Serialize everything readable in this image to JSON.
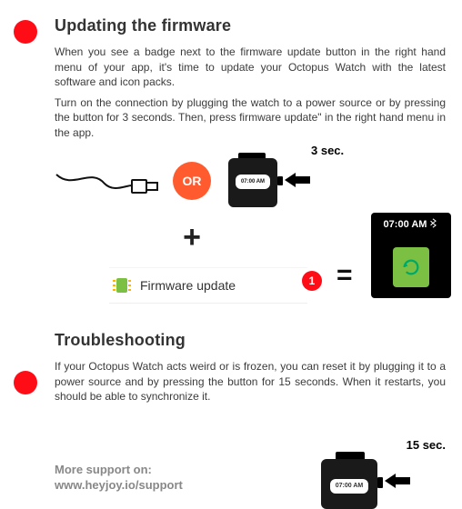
{
  "accent_red": "#ff0d17",
  "accent_orange": "#ff5b2e",
  "accent_green": "#7bc043",
  "section1": {
    "heading": "Updating the firmware",
    "para1": "When you see a badge next to the firmware update button in the right hand menu of your app, it's time to update your Octopus Watch with the latest software and icon packs.",
    "para2": "Turn on the connection by plugging the watch to a power source or by pressing the button for 3 seconds. Then, press firmware update\" in the right hand menu in the app."
  },
  "diagram": {
    "or_label": "OR",
    "watch_time": "07:00 AM",
    "press_duration": "3 sec.",
    "plus": "+",
    "equals": "=",
    "firmware_row_label": "Firmware update",
    "firmware_badge_count": "1",
    "big_screen_time": "07:00 AM"
  },
  "section2": {
    "heading": "Troubleshooting",
    "para1": "If your Octopus Watch acts weird or is frozen, you can reset it by plugging it to a power source and by pressing the button for 15 seconds. When it restarts, you should be able to synchronize it.",
    "press_duration": "15 sec."
  },
  "support": {
    "label": "More support on:",
    "url": "www.heyjoy.io/support"
  }
}
